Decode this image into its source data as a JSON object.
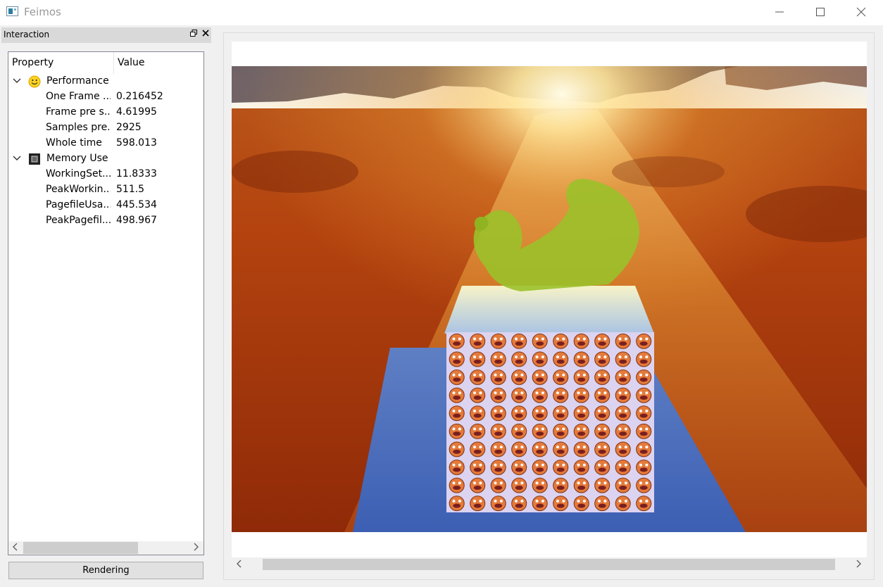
{
  "window": {
    "title": "Feimos"
  },
  "dock": {
    "title": "Interaction"
  },
  "tree": {
    "columns": {
      "property": "Property",
      "value": "Value"
    },
    "categories": [
      {
        "name": "Performance",
        "icon": "smiley-icon",
        "items": [
          {
            "name": "One Frame ...",
            "value": "0.216452"
          },
          {
            "name": "Frame pre s...",
            "value": "4.61995"
          },
          {
            "name": "Samples pre...",
            "value": "2925"
          },
          {
            "name": "Whole time",
            "value": "598.013"
          }
        ]
      },
      {
        "name": "Memory Use",
        "icon": "memory-chip-icon",
        "items": [
          {
            "name": "WorkingSet...",
            "value": "11.8333"
          },
          {
            "name": "PeakWorkin...",
            "value": "511.5"
          },
          {
            "name": "PagefileUsa...",
            "value": "445.534"
          },
          {
            "name": "PeakPagefil...",
            "value": "498.967"
          }
        ]
      }
    ]
  },
  "rendering_button": {
    "label": "Rendering"
  }
}
